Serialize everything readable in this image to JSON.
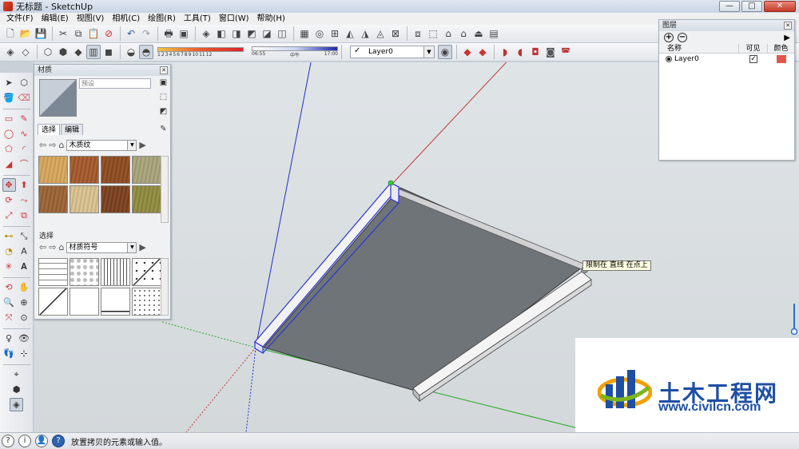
{
  "window": {
    "title": "无标题 - SketchUp",
    "min": "—",
    "max": "□",
    "close": "✕"
  },
  "menu": [
    "文件(F)",
    "编辑(E)",
    "视图(V)",
    "相机(C)",
    "绘图(R)",
    "工具(T)",
    "窗口(W)",
    "帮助(H)"
  ],
  "shadow": {
    "months": [
      "1",
      "2",
      "3",
      "4",
      "5",
      "6",
      "7",
      "8",
      "9",
      "10",
      "11",
      "12"
    ],
    "time_start": "06:55",
    "time_mid": "中午",
    "time_end": "17:00"
  },
  "layer_select": {
    "current": "Layer0",
    "check": "✓"
  },
  "materials": {
    "title": "材质",
    "name_placeholder": "预设",
    "tabs": [
      "选择",
      "编辑"
    ],
    "library1": "木质纹",
    "section2_title": "选择",
    "library2": "材质符号",
    "wood_swatches": [
      "#d6a55a",
      "#a4572a",
      "#8e4a1f",
      "#a8a37a",
      "#9a6233",
      "#d9c08e",
      "#7a3f1d",
      "#8f8a3e"
    ],
    "symbol_swatches": [
      "pattern-bricks",
      "pattern-stones",
      "pattern-lines",
      "pattern-dots",
      "pattern-diagonal",
      "pattern-blank",
      "pattern-line-bottom",
      "pattern-dots2"
    ]
  },
  "layers": {
    "title": "图层",
    "col_name": "名称",
    "col_visible": "可见",
    "col_color": "颜色",
    "rows": [
      {
        "name": "Layer0",
        "visible": "✓",
        "color": "#e2574c"
      }
    ]
  },
  "viewport": {
    "hint": "限制在 直线 在点上"
  },
  "status": {
    "message": "放置拷贝的元素或输入值。",
    "icons": [
      "?",
      "i",
      "👤",
      "?"
    ]
  },
  "watermark": {
    "title": "土木工程网",
    "url": "www.civilcn.com"
  }
}
